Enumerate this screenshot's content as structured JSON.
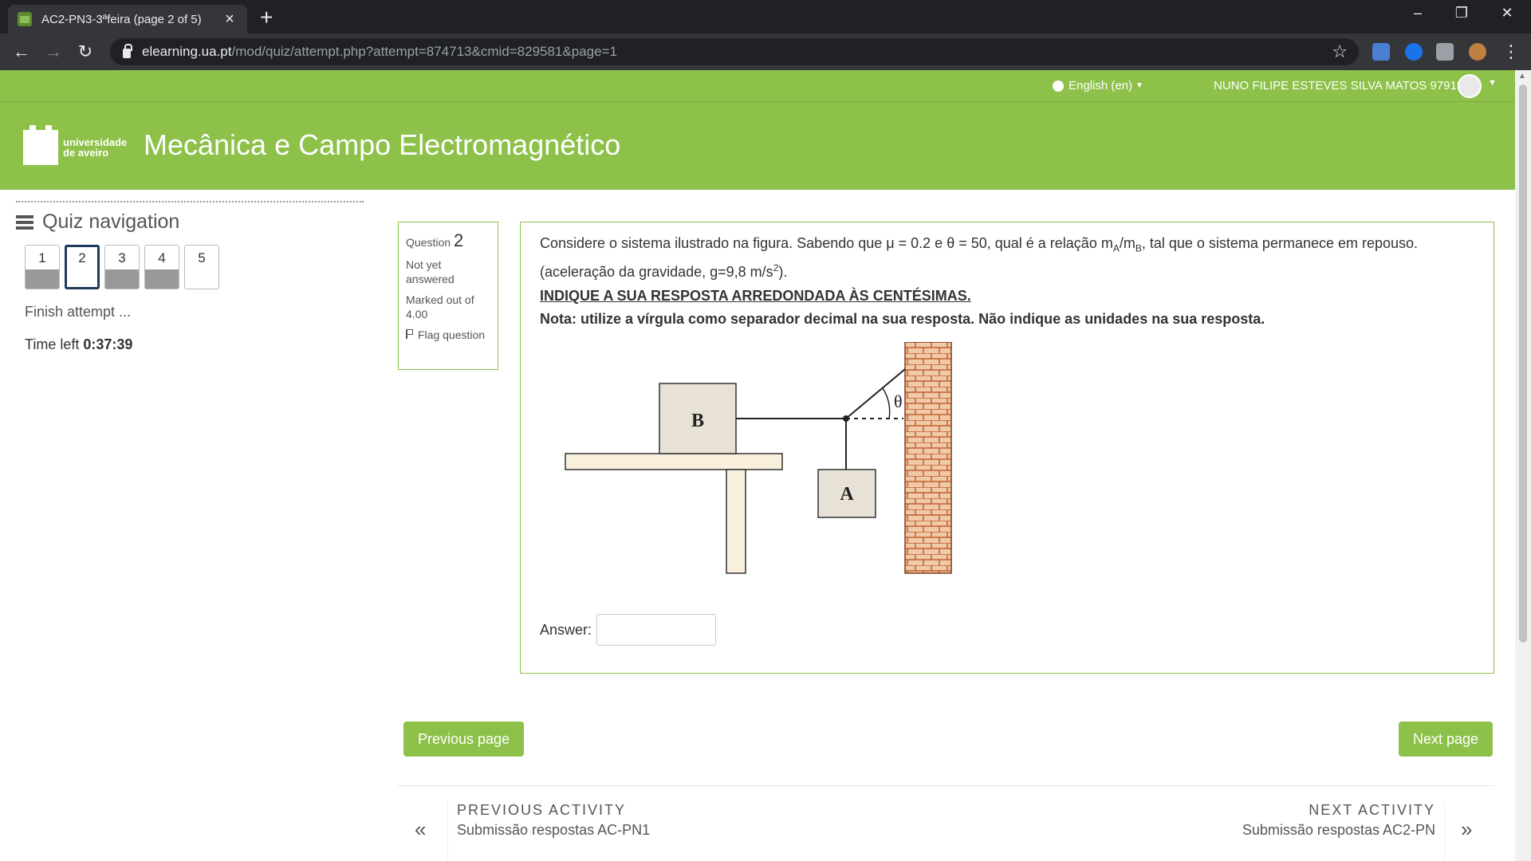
{
  "browser": {
    "tab_title": "AC2-PN3-3ªfeira (page 2 of 5)",
    "url_host": "elearning.ua.pt",
    "url_path": "/mod/quiz/attempt.php?attempt=874713&cmid=829581&page=1"
  },
  "topnav": {
    "language": "English (en)",
    "user_name": "NUNO FILIPE ESTEVES SILVA MATOS 97915"
  },
  "header": {
    "logo_line1": "universidade",
    "logo_line2": "de aveiro",
    "site_title": "Mecânica e Campo Electromagnético"
  },
  "quiz_nav": {
    "title": "Quiz navigation",
    "questions": [
      {
        "label": "1",
        "state": "answered"
      },
      {
        "label": "2",
        "state": "current"
      },
      {
        "label": "3",
        "state": "answered"
      },
      {
        "label": "4",
        "state": "answered"
      },
      {
        "label": "5",
        "state": "unanswered"
      }
    ],
    "finish": "Finish attempt ...",
    "time_left_label": "Time left",
    "time_left_value": "0:37:39"
  },
  "question_info": {
    "question_label": "Question",
    "number": "2",
    "status": "Not yet answered",
    "marked": "Marked out of 4.00",
    "flag": "Flag question"
  },
  "question": {
    "text_part1": "Considere o sistema ilustrado na figura. Sabendo que  μ = 0.2 e θ = 50, qual é a relação m",
    "sub_a": "A",
    "text_part2": "/m",
    "sub_b": "B",
    "text_part3": ", tal que o sistema permanece em repouso. (aceleração da gravidade, g=9,8 m/s",
    "sup_2": "2",
    "text_part4": ").",
    "instruction": "INDIQUE A SUA RESPOSTA ARREDONDADA ÀS CENTÉSIMAS.",
    "note": "Nota: utilize a vírgula como separador decimal na sua resposta. Não indique as unidades na sua resposta.",
    "figure_labels": {
      "block_b": "B",
      "block_a": "A",
      "angle": "θ"
    },
    "answer_label": "Answer:",
    "answer_value": ""
  },
  "buttons": {
    "previous_page": "Previous page",
    "next_page": "Next page"
  },
  "activity_nav": {
    "prev_label": "PREVIOUS ACTIVITY",
    "prev_name": "Submissão respostas AC-PN1",
    "next_label": "NEXT ACTIVITY",
    "next_name": "Submissão respostas AC2-PN"
  },
  "colors": {
    "brand_green": "#8dc14a",
    "current_question_border": "#1d3a5c"
  }
}
